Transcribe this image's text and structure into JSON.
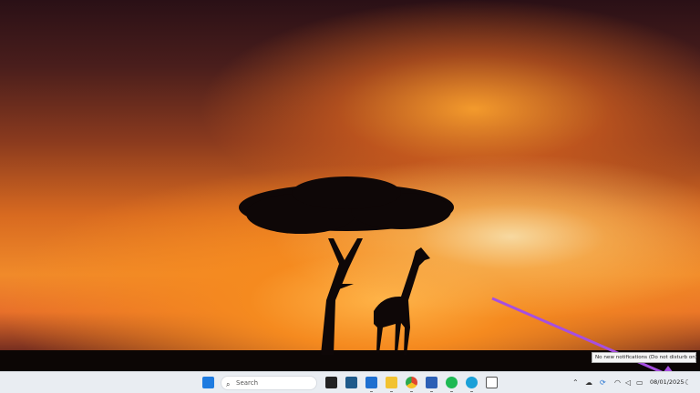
{
  "taskbar": {
    "search_placeholder": "Search",
    "apps": [
      {
        "name": "task-view",
        "color": "#222"
      },
      {
        "name": "store",
        "color": "#1f5a8a"
      },
      {
        "name": "outlook",
        "color": "#1e6fd0"
      },
      {
        "name": "file-explorer",
        "color": "#f2c230"
      },
      {
        "name": "chrome",
        "color": "#e0452f"
      },
      {
        "name": "word",
        "color": "#2b5fb5"
      },
      {
        "name": "spotify",
        "color": "#1db954"
      },
      {
        "name": "edge",
        "color": "#1aa0d8"
      },
      {
        "name": "snipping-tool",
        "color": "#555"
      }
    ],
    "clock_date": "08/01/2025"
  },
  "tooltip": {
    "text": "No new notifications (Do not disturb on)"
  },
  "annotation": {
    "arrow_color": "#a64fe0"
  }
}
